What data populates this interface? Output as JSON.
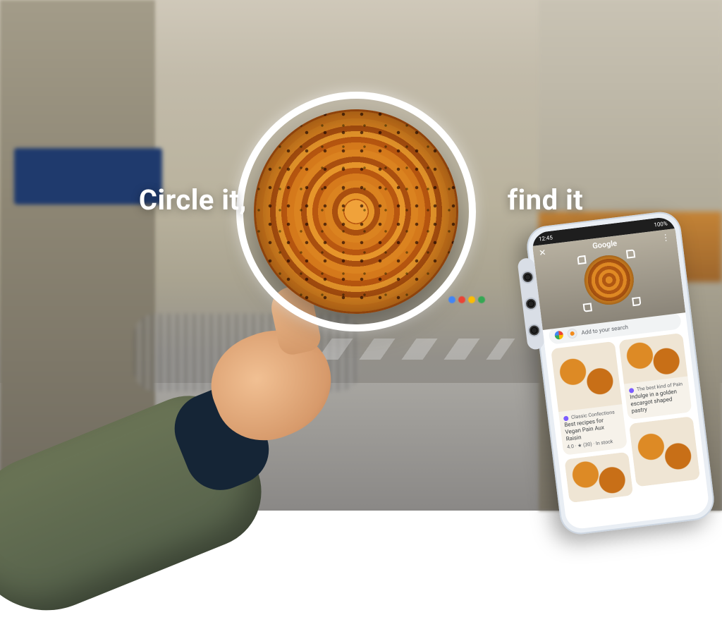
{
  "headline": {
    "left": "Circle it,",
    "right": "find it"
  },
  "phone": {
    "status": {
      "time": "12:45",
      "battery": "100%"
    },
    "hero": {
      "brand": "Google",
      "close": "✕",
      "menu": "⋮"
    },
    "search": {
      "placeholder": "Add to your search"
    },
    "results": {
      "left_top_source": "Classic Confections",
      "left_top_title": "Best recipes for Vegan Pain Aux Raisin",
      "left_top_meta": "4.0 · ★ (30) · In stock",
      "right_top_source": "The best kind of Pain",
      "right_top_title": "Indulge in a golden escargot shaped pastry"
    }
  }
}
